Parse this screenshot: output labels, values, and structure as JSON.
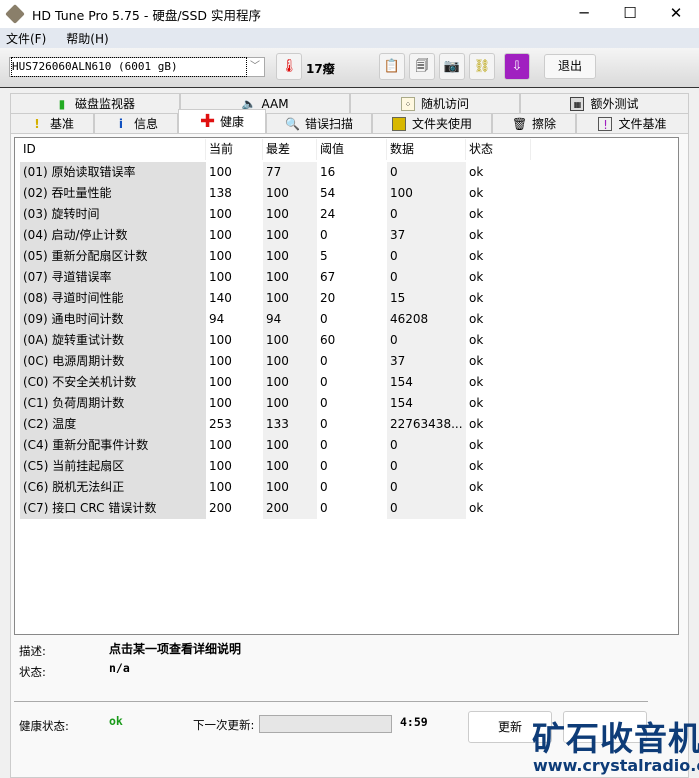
{
  "window": {
    "title": "HD Tune Pro 5.75 - 硬盘/SSD 实用程序",
    "minimize": "─",
    "maximize": "☐",
    "close": "✕"
  },
  "menu": [
    "文件(F)",
    "帮助(H)"
  ],
  "toolbar": {
    "drive": "HUS726060ALN610 (6001 gB)",
    "temperature": "17癈",
    "exit_label": "退出"
  },
  "tabs_top": [
    {
      "label": "磁盘监视器",
      "icon": "chart-icon"
    },
    {
      "label": "AAM",
      "icon": "speaker-icon"
    },
    {
      "label": "随机访问",
      "icon": "scatter-icon"
    },
    {
      "label": "额外测试",
      "icon": "calculator-icon"
    }
  ],
  "tabs_bottom": [
    {
      "label": "基准",
      "icon": "exclamation-icon"
    },
    {
      "label": "信息",
      "icon": "info-icon"
    },
    {
      "label": "健康",
      "icon": "red-cross-icon"
    },
    {
      "label": "错误扫描",
      "icon": "magnifier-icon"
    },
    {
      "label": "文件夹使用",
      "icon": "folder-icon"
    },
    {
      "label": "擦除",
      "icon": "trash-icon"
    },
    {
      "label": "文件基准",
      "icon": "file-benchmark-icon"
    }
  ],
  "table": {
    "headers": [
      "ID",
      "当前",
      "最差",
      "阈值",
      "数据",
      "状态"
    ],
    "rows": [
      [
        "(01) 原始读取错误率",
        "100",
        "77",
        "16",
        "0",
        "ok"
      ],
      [
        "(02) 吞吐量性能",
        "138",
        "100",
        "54",
        "100",
        "ok"
      ],
      [
        "(03) 旋转时间",
        "100",
        "100",
        "24",
        "0",
        "ok"
      ],
      [
        "(04) 启动/停止计数",
        "100",
        "100",
        "0",
        "37",
        "ok"
      ],
      [
        "(05) 重新分配扇区计数",
        "100",
        "100",
        "5",
        "0",
        "ok"
      ],
      [
        "(07) 寻道错误率",
        "100",
        "100",
        "67",
        "0",
        "ok"
      ],
      [
        "(08) 寻道时间性能",
        "140",
        "100",
        "20",
        "15",
        "ok"
      ],
      [
        "(09) 通电时间计数",
        "94",
        "94",
        "0",
        "46208",
        "ok"
      ],
      [
        "(0A) 旋转重试计数",
        "100",
        "100",
        "60",
        "0",
        "ok"
      ],
      [
        "(0C) 电源周期计数",
        "100",
        "100",
        "0",
        "37",
        "ok"
      ],
      [
        "(C0) 不安全关机计数",
        "100",
        "100",
        "0",
        "154",
        "ok"
      ],
      [
        "(C1) 负荷周期计数",
        "100",
        "100",
        "0",
        "154",
        "ok"
      ],
      [
        "(C2) 温度",
        "253",
        "133",
        "0",
        "22763438...",
        "ok"
      ],
      [
        "(C4) 重新分配事件计数",
        "100",
        "100",
        "0",
        "0",
        "ok"
      ],
      [
        "(C5) 当前挂起扇区",
        "100",
        "100",
        "0",
        "0",
        "ok"
      ],
      [
        "(C6) 脱机无法纠正",
        "100",
        "100",
        "0",
        "0",
        "ok"
      ],
      [
        "(C7) 接口 CRC 错误计数",
        "200",
        "200",
        "0",
        "0",
        "ok"
      ]
    ]
  },
  "details": {
    "desc_label": "描述:",
    "desc_value": "点击某一项查看详细说明",
    "status_label": "状态:",
    "status_value": "n/a"
  },
  "footer": {
    "health_label": "健康状态:",
    "health_value": "ok",
    "next_update_label": "下一次更新:",
    "countdown": "4:59",
    "update_button": "更新",
    "health_color": "#1a9a1a"
  },
  "watermark": {
    "name": "矿石收音机",
    "url": "www.crystalradio.cn"
  }
}
